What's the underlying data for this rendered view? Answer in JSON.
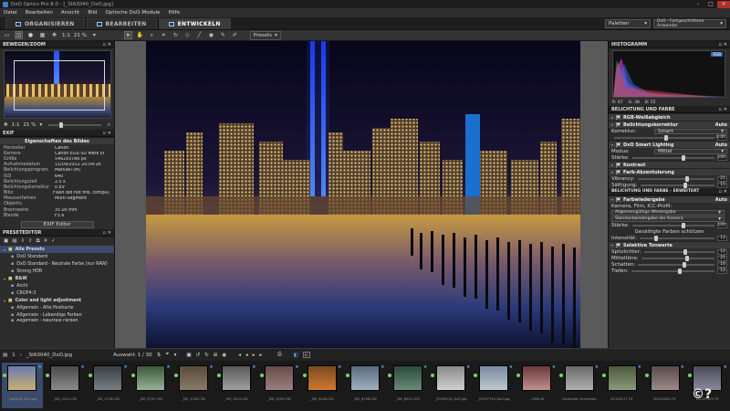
{
  "window": {
    "title": "DxO Optics Pro 8.0 - [_SIA3040_DxO.jpg]"
  },
  "menu": [
    "Datei",
    "Bearbeiten",
    "Ansicht",
    "Bild",
    "Optische DxO-Module",
    "Hilfe"
  ],
  "tabs": [
    {
      "label": "ORGANISIEREN",
      "active": false
    },
    {
      "label": "BEARBEITEN",
      "active": false
    },
    {
      "label": "ENTWICKELN",
      "active": true
    }
  ],
  "workspace": {
    "palettes_label": "Paletten",
    "preset": "DxO - Fortgeschrittene Anwender"
  },
  "toolbar": {
    "scale": "1:1",
    "zoom": "21 %",
    "presets": "Presets"
  },
  "left": {
    "nav_header": "BEWEGEN/ZOOM",
    "nav_scale": "1:1",
    "nav_zoom": "21 %",
    "exif_header": "EXIF",
    "exif_title": "Eigenschaften des Bildes",
    "exif": [
      {
        "k": "Hersteller",
        "v": "Canon"
      },
      {
        "k": "Kamera",
        "v": "Canon EOS 5D Mark III"
      },
      {
        "k": "Größe",
        "v": "5462x3786 px"
      },
      {
        "k": "Aufnahmedatum",
        "v": "11/09/2012 20:54:26"
      },
      {
        "k": "Belichtungsprogram",
        "v": "Manuell (M)"
      },
      {
        "k": "ISO",
        "v": "640"
      },
      {
        "k": "Belichtungszeit",
        "v": "2.5 s"
      },
      {
        "k": "Belichtungskorrektur",
        "v": "0 EV"
      },
      {
        "k": "Blitz",
        "v": "Flash did not fire, compul..."
      },
      {
        "k": "Messverfahren",
        "v": "Multi-Segment"
      },
      {
        "k": "Objektiv",
        "v": ""
      },
      {
        "k": "Brennweite",
        "v": "35.00 mm"
      },
      {
        "k": "Blende",
        "v": "F5.6"
      }
    ],
    "exif_editor": "EXIF Editor",
    "preset_header": "PRESETEDITOR",
    "presets": [
      {
        "label": "Alle Presets",
        "level": 0,
        "sel": true
      },
      {
        "label": "DxO Standard",
        "level": 1
      },
      {
        "label": "DxO Standard - Neutrale Farbe (nur RAW)",
        "level": 1
      },
      {
        "label": "Strong HDR",
        "level": 1
      },
      {
        "label": "B&W",
        "level": 0,
        "folder": true
      },
      {
        "label": "Archi",
        "level": 1
      },
      {
        "label": "CROP4:3",
        "level": 1
      },
      {
        "label": "Color and light adjustment",
        "level": 0,
        "folder": true
      },
      {
        "label": "Allgemein - Alte Postkarte",
        "level": 1
      },
      {
        "label": "Allgemein - Lebendige Farben",
        "level": 1
      },
      {
        "label": "Allgemein - Neutrale Farben",
        "level": 1
      }
    ]
  },
  "right": {
    "histogram_header": "HISTOGRAMM",
    "rgb": "RGB",
    "hist_vals": {
      "r": "R: 47",
      "g": "G: 38",
      "b": "B: 55"
    },
    "section1": "BELICHTUNG UND FARBE",
    "s1": {
      "wb": "RGB-Weißabgleich",
      "exp": "Belichtungskorrektur",
      "exp_auto": "Auto",
      "korrektur_label": "Korrektur:",
      "korrektur_val": "Smart",
      "korrektur_num": "0.00",
      "smart": "DxO Smart Lighting",
      "smart_auto": "Auto",
      "modus_label": "Modus:",
      "modus_val": "Mittel",
      "staerke_label": "Stärke:",
      "staerke_num": "100",
      "kontrast": "Kontrast",
      "farb": "Farb-Akzentuierung",
      "vibrancy_label": "Vibrancy:",
      "vibrancy_num": "21",
      "saettigung_label": "Sättigung:",
      "saettigung_num": "15"
    },
    "section2": "BELICHTUNG UND FARBE - ERWEITERT",
    "s2": {
      "farbwieder": "Farbwiedergabe",
      "auto": "Auto",
      "kamera_label": "Kamera, Film, ICC-Profil:",
      "kamera_val": "Allgemeingültige Wiedergabe",
      "standard_val": "Standardwiedergabe der Kamera",
      "staerke_label": "Stärke:",
      "staerke_num": "100",
      "gesaettigt": "Gesättigte Farben schützen",
      "intensitaet_label": "Intensität:",
      "intensitaet_num": "12",
      "tonwerte": "Selektive Tonwerte",
      "spitz_label": "Spitzlichter:",
      "spitz_num": "12",
      "mittel_label": "Mitteltöne:",
      "mittel_num": "21",
      "schatten_label": "Schatten:",
      "schatten_num": "16",
      "tiefen_label": "Tiefen:",
      "tiefen_num": "12"
    }
  },
  "filmbar": {
    "count": "1",
    "folder": "_SIA3040_DxO.jpg",
    "selection": "Auswahl: 1 / 30"
  },
  "thumbs": [
    {
      "label": "_SIA3040_DxO.jpg",
      "c1": "#6a7bb0",
      "c2": "#c7b070"
    },
    {
      "label": "_MG_2211.CR2",
      "c1": "#4a4a4a",
      "c2": "#8a8a8a"
    },
    {
      "label": "_MG_2718.CR2",
      "c1": "#3a3f45",
      "c2": "#7a7f85"
    },
    {
      "label": "_MG_2797.CR2",
      "c1": "#3a5a3a",
      "c2": "#9ab09a"
    },
    {
      "label": "_MG_3330.CR2",
      "c1": "#5a4a3a",
      "c2": "#8a7a6a"
    },
    {
      "label": "_MG_3443.CR2",
      "c1": "#5a5a5a",
      "c2": "#a0a0a0"
    },
    {
      "label": "_MG_3990.CR2",
      "c1": "#6a4a4a",
      "c2": "#9a8080"
    },
    {
      "label": "_MG_5008.CR2",
      "c1": "#7a4a20",
      "c2": "#d07a30"
    },
    {
      "label": "_MG_8198.CR2",
      "c1": "#5a6a7a",
      "c2": "#a0b0c0"
    },
    {
      "label": "_MG_8952.CR2",
      "c1": "#2a4a3a",
      "c2": "#6a8a7a"
    },
    {
      "label": "_V7099130_DxO.jpg",
      "c1": "#8a8a8a",
      "c2": "#d0d0d0"
    },
    {
      "label": "_V7097740_DxO.jpg",
      "c1": "#7a8aa0",
      "c2": "#c0c8d0"
    },
    {
      "label": "...0358.tif",
      "c1": "#6a3a3a",
      "c2": "#c09090"
    },
    {
      "label": "Constantin Fernandes",
      "c1": "#6a6a6a",
      "c2": "#b0b0b0"
    },
    {
      "label": "D2149177.TIF",
      "c1": "#4a5a3a",
      "c2": "#8a9a7a"
    },
    {
      "label": "D2149281.TIF",
      "c1": "#5a4a4a",
      "c2": "#9a8a8a"
    },
    {
      "label": "D2149303.TIF",
      "c1": "#4a4a5a",
      "c2": "#8a8a9a"
    }
  ],
  "watermark": "©?"
}
